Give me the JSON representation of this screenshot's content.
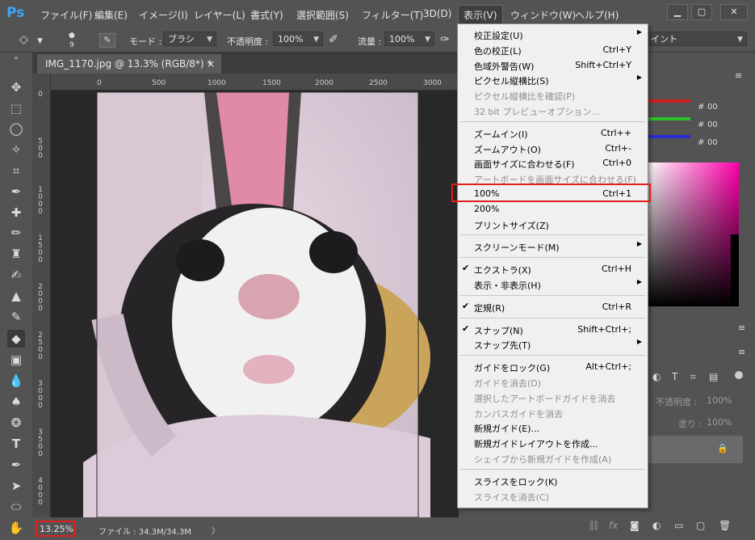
{
  "app": {
    "logo": "Ps"
  },
  "menubar": {
    "items": [
      "ファイル(F)",
      "編集(E)",
      "イメージ(I)",
      "レイヤー(L)",
      "書式(Y)",
      "選択範囲(S)",
      "フィルター(T)",
      "3D(D)",
      "表示(V)",
      "ウィンドウ(W)",
      "ヘルプ(H)"
    ],
    "active": "表示(V)",
    "window_controls": [
      "minimize",
      "maximize",
      "close"
    ]
  },
  "options_bar": {
    "brush_size": "9",
    "mode_label": "モード :",
    "mode_value": "ブラシ",
    "opacity_label": "不透明度 :",
    "opacity_value": "100%",
    "flow_label": "流量 :",
    "flow_value": "100%",
    "right_label": "イント"
  },
  "document_tab": {
    "title": "IMG_1170.jpg @ 13.3% (RGB/8*) *",
    "close": "×"
  },
  "ruler": {
    "h_labels": [
      "0",
      "500",
      "1000",
      "1500",
      "2000",
      "2500",
      "3000"
    ],
    "v_labels": [
      "0",
      "5 0 0",
      "1 0 0 0",
      "1 5 0 0",
      "2 0 0 0",
      "2 5 0 0",
      "3 0 0 0",
      "3 5 0 0",
      "4 0 0 0"
    ]
  },
  "status_bar": {
    "zoom": "13.25%",
    "file_info": "ファイル : 34.3M/34.3M",
    "arrow": "〉"
  },
  "view_menu": {
    "groups": [
      [
        {
          "label": "校正設定(U)",
          "shortcut": "",
          "submenu": true,
          "disabled": false,
          "checked": false
        },
        {
          "label": "色の校正(L)",
          "shortcut": "Ctrl+Y",
          "submenu": false,
          "disabled": false,
          "checked": false
        },
        {
          "label": "色域外警告(W)",
          "shortcut": "Shift+Ctrl+Y",
          "submenu": false,
          "disabled": false,
          "checked": false
        },
        {
          "label": "ピクセル縦横比(S)",
          "shortcut": "",
          "submenu": true,
          "disabled": false,
          "checked": false
        },
        {
          "label": "ピクセル縦横比を確認(P)",
          "shortcut": "",
          "submenu": false,
          "disabled": true,
          "checked": false
        },
        {
          "label": "32 bit プレビューオプション...",
          "shortcut": "",
          "submenu": false,
          "disabled": true,
          "checked": false
        }
      ],
      [
        {
          "label": "ズームイン(I)",
          "shortcut": "Ctrl++",
          "submenu": false,
          "disabled": false,
          "checked": false
        },
        {
          "label": "ズームアウト(O)",
          "shortcut": "Ctrl+-",
          "submenu": false,
          "disabled": false,
          "checked": false
        },
        {
          "label": "画面サイズに合わせる(F)",
          "shortcut": "Ctrl+0",
          "submenu": false,
          "disabled": false,
          "checked": false
        },
        {
          "label": "アートボードを画面サイズに合わせる(F)",
          "shortcut": "",
          "submenu": false,
          "disabled": true,
          "checked": false
        },
        {
          "label": "100%",
          "shortcut": "Ctrl+1",
          "submenu": false,
          "disabled": false,
          "checked": false,
          "highlighted": true
        },
        {
          "label": "200%",
          "shortcut": "",
          "submenu": false,
          "disabled": false,
          "checked": false
        },
        {
          "label": "プリントサイズ(Z)",
          "shortcut": "",
          "submenu": false,
          "disabled": false,
          "checked": false
        }
      ],
      [
        {
          "label": "スクリーンモード(M)",
          "shortcut": "",
          "submenu": true,
          "disabled": false,
          "checked": false
        }
      ],
      [
        {
          "label": "エクストラ(X)",
          "shortcut": "Ctrl+H",
          "submenu": false,
          "disabled": false,
          "checked": true
        },
        {
          "label": "表示・非表示(H)",
          "shortcut": "",
          "submenu": true,
          "disabled": false,
          "checked": false
        }
      ],
      [
        {
          "label": "定規(R)",
          "shortcut": "Ctrl+R",
          "submenu": false,
          "disabled": false,
          "checked": true
        }
      ],
      [
        {
          "label": "スナップ(N)",
          "shortcut": "Shift+Ctrl+;",
          "submenu": false,
          "disabled": false,
          "checked": true
        },
        {
          "label": "スナップ先(T)",
          "shortcut": "",
          "submenu": true,
          "disabled": false,
          "checked": false
        }
      ],
      [
        {
          "label": "ガイドをロック(G)",
          "shortcut": "Alt+Ctrl+;",
          "submenu": false,
          "disabled": false,
          "checked": false
        },
        {
          "label": "ガイドを消去(D)",
          "shortcut": "",
          "submenu": false,
          "disabled": true,
          "checked": false
        },
        {
          "label": "選択したアートボードガイドを消去",
          "shortcut": "",
          "submenu": false,
          "disabled": true,
          "checked": false
        },
        {
          "label": "カンバスガイドを消去",
          "shortcut": "",
          "submenu": false,
          "disabled": true,
          "checked": false
        },
        {
          "label": "新規ガイド(E)...",
          "shortcut": "",
          "submenu": false,
          "disabled": false,
          "checked": false
        },
        {
          "label": "新規ガイドレイアウトを作成...",
          "shortcut": "",
          "submenu": false,
          "disabled": false,
          "checked": false
        },
        {
          "label": "シェイプから新規ガイドを作成(A)",
          "shortcut": "",
          "submenu": false,
          "disabled": true,
          "checked": false
        }
      ],
      [
        {
          "label": "スライスをロック(K)",
          "shortcut": "",
          "submenu": false,
          "disabled": false,
          "checked": false
        },
        {
          "label": "スライスを消去(C)",
          "shortcut": "",
          "submenu": false,
          "disabled": true,
          "checked": false
        }
      ]
    ]
  },
  "color_panel": {
    "r": "00",
    "g": "00",
    "b": "00"
  },
  "layers_panel": {
    "opacity_label": "不透明度 :",
    "opacity_value": "100%",
    "fill_label": "塗り :",
    "fill_value": "100%"
  },
  "colors": {
    "accent": "#38a7f5",
    "highlight_box": "#e01f1f",
    "menu_bg": "#f0f0f0",
    "ui_bg": "#535353"
  }
}
